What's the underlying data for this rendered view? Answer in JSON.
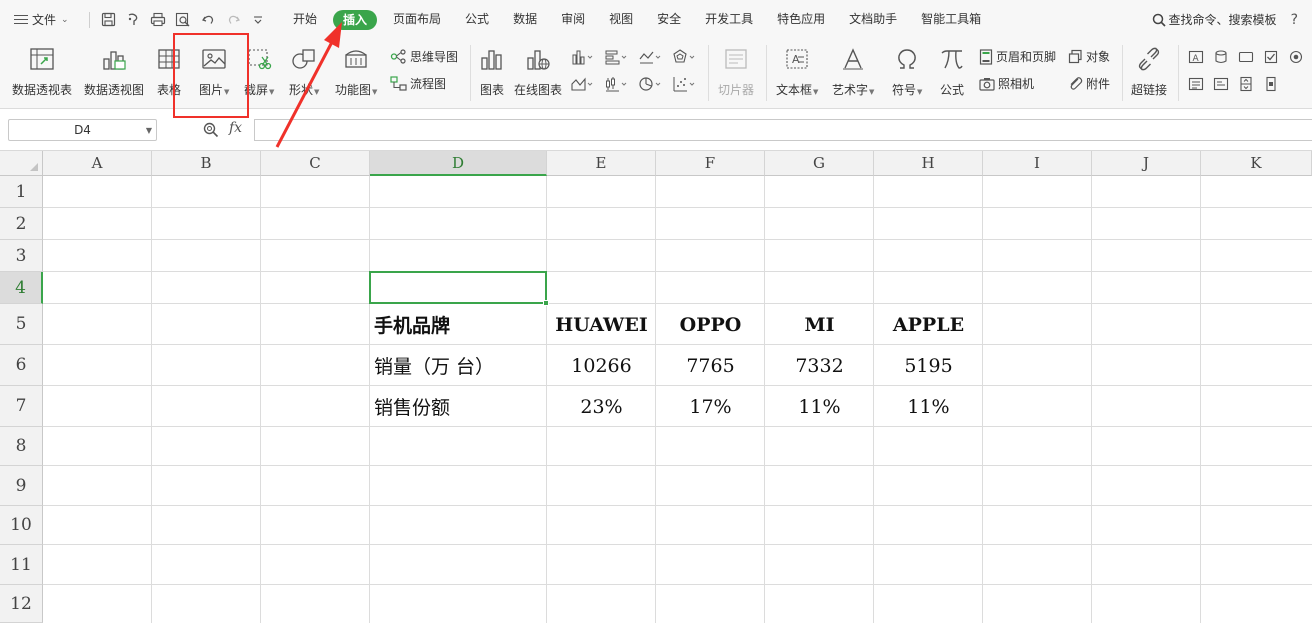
{
  "menubar": {
    "file_label": "文件",
    "tabs": [
      {
        "label": "开始"
      },
      {
        "label": "插入",
        "active": true
      },
      {
        "label": "页面布局"
      },
      {
        "label": "公式"
      },
      {
        "label": "数据"
      },
      {
        "label": "审阅"
      },
      {
        "label": "视图"
      },
      {
        "label": "安全"
      },
      {
        "label": "开发工具"
      },
      {
        "label": "特色应用"
      },
      {
        "label": "文档助手"
      },
      {
        "label": "智能工具箱"
      }
    ],
    "search_label": "查找命令、搜索模板",
    "help_label": "?"
  },
  "ribbon": {
    "pivot_table": "数据透视表",
    "pivot_chart": "数据透视图",
    "table": "表格",
    "picture": "图片",
    "screenshot": "截屏",
    "shapes": "形状",
    "function_chart": "功能图",
    "mindmap": "思维导图",
    "flowchart": "流程图",
    "chart": "图表",
    "online_chart": "在线图表",
    "slicer": "切片器",
    "textbox": "文本框",
    "wordart": "艺术字",
    "symbol": "符号",
    "formula": "公式",
    "header_footer": "页眉和页脚",
    "camera": "照相机",
    "object": "对象",
    "attachment": "附件",
    "hyperlink": "超链接"
  },
  "formulabar": {
    "cell_ref": "D4",
    "fx_label": "fx",
    "formula_value": ""
  },
  "sheet": {
    "columns": [
      "A",
      "B",
      "C",
      "D",
      "E",
      "F",
      "G",
      "H",
      "I",
      "J",
      "K"
    ],
    "rows": [
      "1",
      "2",
      "3",
      "4",
      "5",
      "6",
      "7",
      "8",
      "9",
      "10",
      "11",
      "12"
    ],
    "selected_column": "D",
    "selected_row": "4",
    "table": {
      "header": {
        "label": "手机品牌",
        "brands": [
          "HUAWEI",
          "OPPO",
          "MI",
          "APPLE"
        ]
      },
      "sales": {
        "label": "销量（万 台）",
        "values": [
          "10266",
          "7765",
          "7332",
          "5195"
        ]
      },
      "share": {
        "label": "销售份额",
        "values": [
          "23%",
          "17%",
          "11%",
          "11%"
        ]
      }
    }
  },
  "colors": {
    "accent": "#3aa54b",
    "annotation": "#f0312a"
  }
}
